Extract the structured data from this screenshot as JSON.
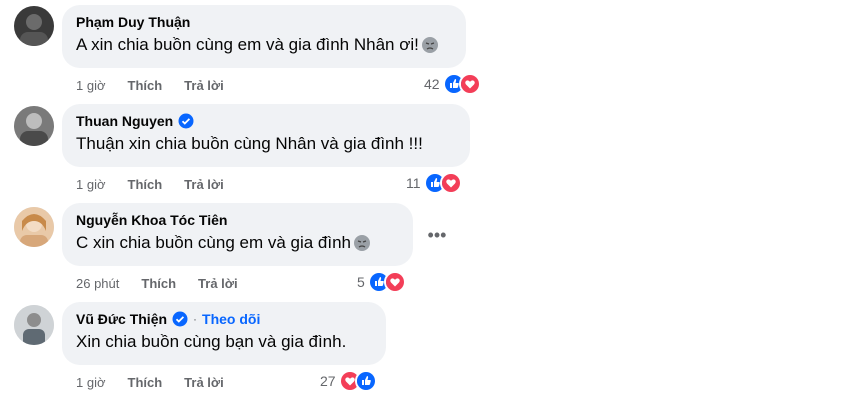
{
  "comments": [
    {
      "author": "Phạm Duy Thuận",
      "verified": false,
      "text": "A xin chia buồn cùng em và gia đình Nhân ơi!",
      "emoji": "pensive-face-emoji",
      "time": "1 giờ",
      "like_label": "Thích",
      "reply_label": "Trả lời",
      "reaction_count": "42",
      "reactions": [
        "like",
        "love"
      ]
    },
    {
      "author": "Thuan Nguyen",
      "verified": true,
      "text": "Thuận xin chia buồn cùng Nhân và gia đình !!!",
      "emoji": "",
      "time": "1 giờ",
      "like_label": "Thích",
      "reply_label": "Trả lời",
      "reaction_count": "11",
      "reactions": [
        "like",
        "love"
      ]
    },
    {
      "author": "Nguyễn Khoa Tóc Tiên",
      "verified": false,
      "text": "C xin chia buồn cùng em và gia đình",
      "emoji": "pensive-face-emoji",
      "time": "26 phút",
      "like_label": "Thích",
      "reply_label": "Trả lời",
      "reaction_count": "5",
      "reactions": [
        "like",
        "love"
      ],
      "more_icon": "more-horizontal-icon"
    },
    {
      "author": "Vũ Đức Thiện",
      "verified": true,
      "follow_separator": "·",
      "follow_label": "Theo dõi",
      "text": "Xin chia buồn cùng bạn và gia đình.",
      "emoji": "",
      "time": "1 giờ",
      "like_label": "Thích",
      "reply_label": "Trả lời",
      "reaction_count": "27",
      "reactions": [
        "love",
        "like"
      ]
    }
  ],
  "colors": {
    "bubble": "#f0f2f5",
    "like_blue": "#0866ff",
    "love_red": "#f33e58",
    "meta_gray": "#65676b"
  }
}
